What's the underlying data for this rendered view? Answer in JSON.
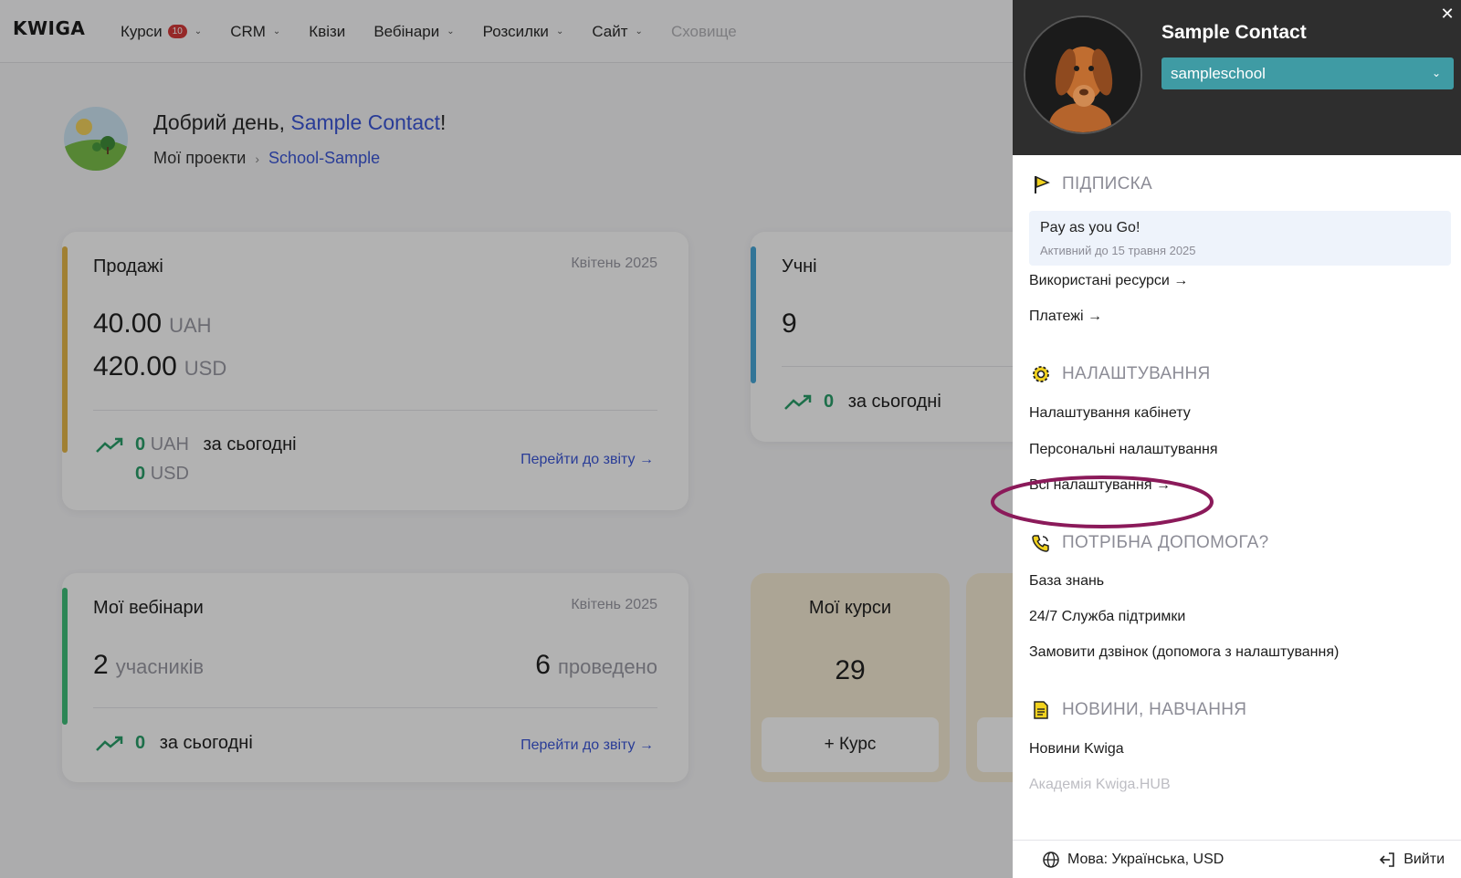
{
  "brand": {
    "logo": "KWIGA"
  },
  "nav": {
    "items": [
      {
        "label": "Курси",
        "badge": "10",
        "has_dropdown": true
      },
      {
        "label": "CRM",
        "has_dropdown": true
      },
      {
        "label": "Квізи",
        "has_dropdown": false
      },
      {
        "label": "Вебінари",
        "has_dropdown": true
      },
      {
        "label": "Розсилки",
        "has_dropdown": true
      },
      {
        "label": "Сайт",
        "has_dropdown": true
      },
      {
        "label": "Сховище",
        "has_dropdown": false,
        "muted": true
      }
    ]
  },
  "greeting": {
    "prefix": "Добрий день, ",
    "name": "Sample Contact",
    "suffix": "!",
    "crumb_root": "Мої проекти",
    "crumb_current": "School-Sample"
  },
  "sales": {
    "title": "Продажі",
    "date": "Квітень 2025",
    "amount1": "40.00",
    "currency1": "UAH",
    "amount2": "420.00",
    "currency2": "USD",
    "today_value1": "0",
    "today_unit1": "UAH",
    "today_label": "за сьогодні",
    "today_value2": "0",
    "today_unit2": "USD",
    "report_link": "Перейти до звіту →",
    "accent": "#e6b84a"
  },
  "students": {
    "title": "Учні",
    "count": "9",
    "today_value": "0",
    "today_label": "за сьогодні",
    "accent": "#4aa8d8"
  },
  "webinars": {
    "title": "Мої вебінари",
    "date": "Квітень 2025",
    "participants_value": "2",
    "participants_label": "учасників",
    "held_value": "6",
    "held_label": "проведено",
    "today_value": "0",
    "today_label": "за сьогодні",
    "report_link": "Перейти до звіту →",
    "accent": "#3fbf7a"
  },
  "courses": {
    "title": "Мої курси",
    "count": "29",
    "add_button": "+ Курс"
  },
  "drawer": {
    "close": "✕",
    "profile_name": "Sample Contact",
    "school": "sampleschool",
    "subscription": {
      "heading": "ПІДПИСКА",
      "plan_name": "Pay as you Go!",
      "plan_status": "Активний до 15 травня 2025",
      "links": [
        "Використані ресурси →",
        "Платежі →"
      ]
    },
    "settings": {
      "heading": "НАЛАШТУВАННЯ",
      "links": [
        "Налаштування кабінету",
        "Персональні налаштування",
        "Всі налаштування →"
      ]
    },
    "help": {
      "heading": "ПОТРІБНА ДОПОМОГА?",
      "links": [
        "База знань",
        "24/7 Служба підтримки",
        "Замовити дзвінок (допомога з налаштування)"
      ]
    },
    "news": {
      "heading": "НОВИНИ, НАВЧАННЯ",
      "links": [
        "Новини Kwiga",
        "Академія Kwiga.HUB"
      ]
    },
    "footer": {
      "language": "Мова: Українська, USD",
      "logout": "Вийти"
    },
    "highlight_color": "#8b1a5a"
  }
}
